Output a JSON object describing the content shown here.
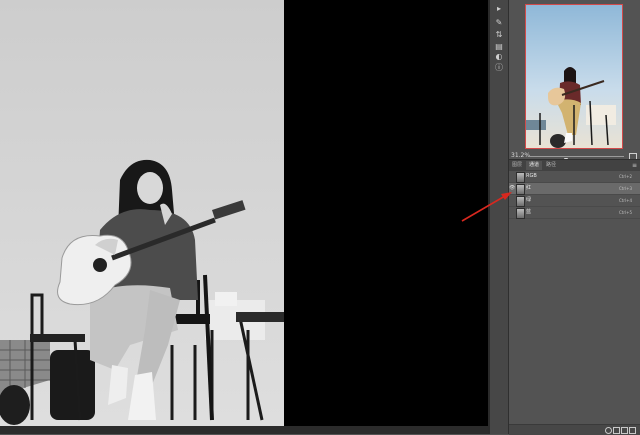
{
  "canvas": {
    "background": "#000000"
  },
  "navigator": {
    "zoom": "31.2%",
    "slider_level": 0.38
  },
  "panel_tabs": [
    "图层",
    "通道",
    "路径"
  ],
  "active_tab": "通道",
  "channels": [
    {
      "name": "RGB",
      "shortcut": "Ctrl+2",
      "selected": false,
      "visible": false
    },
    {
      "name": "红",
      "shortcut": "Ctrl+3",
      "selected": true,
      "visible": true
    },
    {
      "name": "绿",
      "shortcut": "Ctrl+4",
      "selected": false,
      "visible": false
    },
    {
      "name": "蓝",
      "shortcut": "Ctrl+5",
      "selected": false,
      "visible": false
    }
  ],
  "annotation": {
    "color": "#d8281f"
  },
  "toolstrip_icons": [
    "play-icon",
    "brush-icon",
    "swap-icon",
    "history-icon",
    "adjust-icon",
    "info-icon"
  ],
  "footer_icons": [
    "load-selection-icon",
    "save-selection-icon",
    "new-channel-icon",
    "delete-icon"
  ]
}
